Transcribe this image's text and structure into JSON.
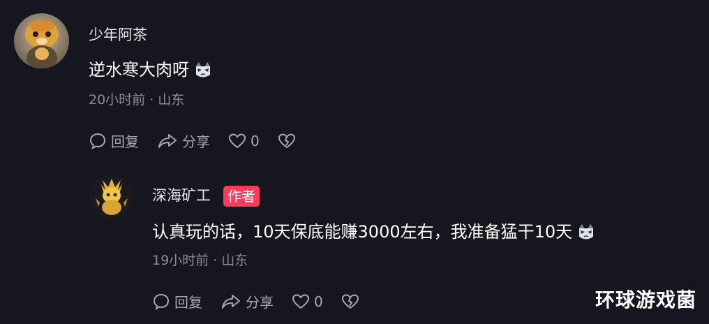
{
  "comments": [
    {
      "username": "少年阿茶",
      "text": "逆水寒大肉呀",
      "meta": "20小时前 · 山东",
      "reply_label": "回复",
      "share_label": "分享",
      "like_count": "0"
    },
    {
      "username": "深海矿工",
      "badge": "作者",
      "text": "认真玩的话，10天保底能赚3000左右，我准备猛干10天",
      "meta": "19小时前 · 山东",
      "reply_label": "回复",
      "share_label": "分享",
      "like_count": "0"
    }
  ],
  "watermark": "环球游戏菌",
  "colors": {
    "background": "#16161e",
    "badge": "#ff3b5c",
    "meta": "#8c8c96",
    "action": "#a8a8b2"
  },
  "icons": [
    "comment-bubble-icon",
    "share-arrow-icon",
    "heart-icon",
    "broken-heart-icon",
    "cat-emoji-icon"
  ]
}
